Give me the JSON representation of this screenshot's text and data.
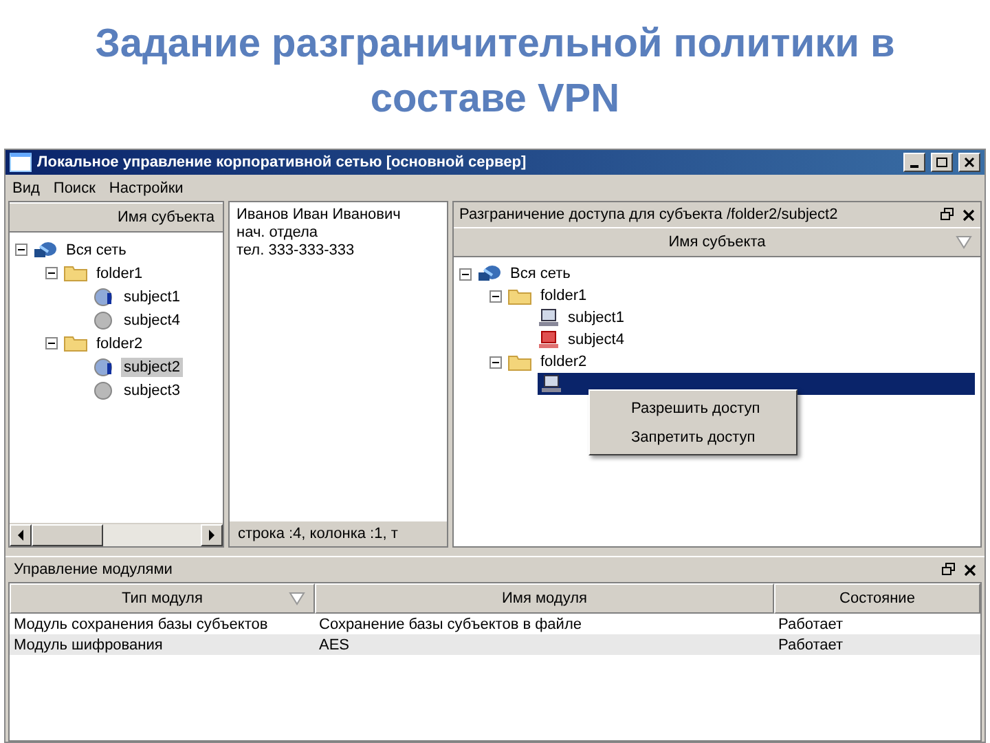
{
  "slide_title": "Задание разграничительной политики в составе VPN",
  "window": {
    "title": "Локальное управление корпоративной сетью [основной сервер]"
  },
  "menu": [
    "Вид",
    "Поиск",
    "Настройки"
  ],
  "subjects_panel": {
    "column": "Имя субъекта",
    "tree": [
      {
        "label": "Вся сеть",
        "kind": "network",
        "expanded": true,
        "selected": false,
        "children": [
          {
            "label": "folder1",
            "kind": "folder",
            "expanded": true,
            "selected": false,
            "children": [
              {
                "label": "subject1",
                "kind": "subject",
                "online": true,
                "selected": false
              },
              {
                "label": "subject4",
                "kind": "subject",
                "online": false,
                "selected": false
              }
            ]
          },
          {
            "label": "folder2",
            "kind": "folder",
            "expanded": true,
            "selected": false,
            "children": [
              {
                "label": "subject2",
                "kind": "subject",
                "online": true,
                "selected": true
              },
              {
                "label": "subject3",
                "kind": "subject",
                "online": false,
                "selected": false
              }
            ]
          }
        ]
      }
    ]
  },
  "details": {
    "lines": [
      "Иванов Иван Иванович",
      "нач. отдела",
      "тел. 333-333-333"
    ],
    "status": "строка :4, колонка :1, т"
  },
  "access_panel": {
    "title": "Разграничение доступа для субъекта /folder2/subject2",
    "column": "Имя субъекта",
    "tree": [
      {
        "label": "Вся сеть",
        "kind": "network",
        "expanded": true,
        "selected": false,
        "children": [
          {
            "label": "folder1",
            "kind": "folder",
            "expanded": true,
            "selected": false,
            "children": [
              {
                "label": "subject1",
                "kind": "subject",
                "denied": false,
                "selected": false
              },
              {
                "label": "subject4",
                "kind": "subject",
                "denied": true,
                "selected": false
              }
            ]
          },
          {
            "label": "folder2",
            "kind": "folder",
            "expanded": true,
            "selected": false,
            "children": [
              {
                "kind": "subject",
                "denied": false,
                "selected": true
              }
            ]
          }
        ]
      }
    ],
    "context_menu": [
      "Разрешить доступ",
      "Запретить доступ"
    ]
  },
  "modules_panel": {
    "title": "Управление модулями",
    "columns": [
      "Тип модуля",
      "Имя модуля",
      "Состояние"
    ],
    "rows": [
      [
        "Модуль сохранения базы субъектов",
        "Сохранение базы субъектов в файле",
        "Работает"
      ],
      [
        "Модуль шифрования",
        "AES",
        "Работает"
      ]
    ]
  }
}
